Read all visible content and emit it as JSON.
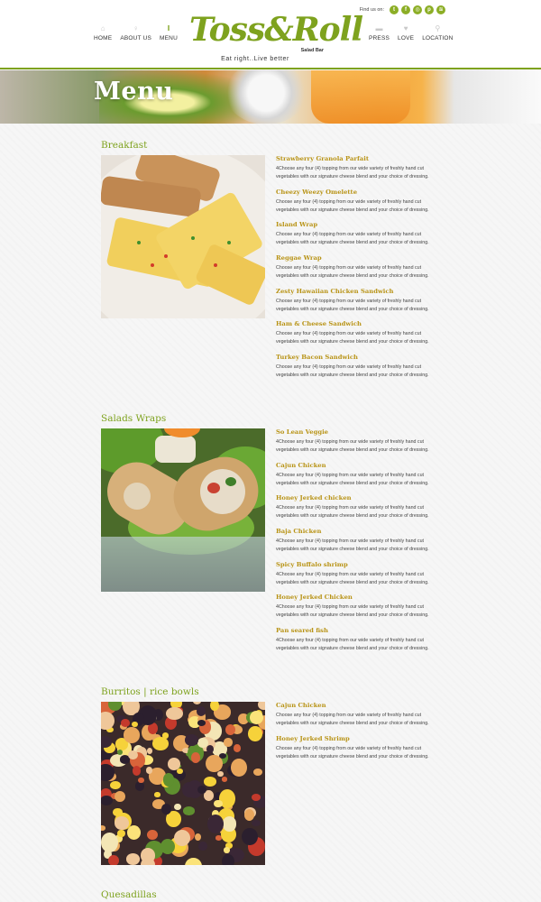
{
  "header": {
    "nav_left": [
      {
        "label": "HOME",
        "icon": "house-icon",
        "glyph": "⌂"
      },
      {
        "label": "ABOUT US",
        "icon": "person-icon",
        "glyph": "♀"
      },
      {
        "label": "MENU",
        "icon": "fork-knife-icon",
        "glyph": "ǁ"
      }
    ],
    "nav_right": [
      {
        "label": "PRESS",
        "icon": "chat-icon",
        "glyph": "▬"
      },
      {
        "label": "LOVE",
        "icon": "heart-icon",
        "glyph": "♥"
      },
      {
        "label": "LOCATION",
        "icon": "pin-icon",
        "glyph": "⚲"
      }
    ],
    "logo": {
      "script": "Toss&Roll",
      "sub": "Salad Bar",
      "tagline": "Eat right..Live better"
    },
    "find_us": {
      "label": "Find us on:",
      "icons": [
        {
          "name": "twitter-icon",
          "glyph": "t"
        },
        {
          "name": "facebook-icon",
          "glyph": "f"
        },
        {
          "name": "instagram-icon",
          "glyph": "◎"
        },
        {
          "name": "pinterest-icon",
          "glyph": "p"
        },
        {
          "name": "rss-icon",
          "glyph": "≋"
        }
      ]
    },
    "accent_color": "#7ea21e"
  },
  "banner": {
    "title": "Menu"
  },
  "sections": [
    {
      "title": "Breakfast",
      "items": [
        {
          "name": "Strawberry Granola Parfait",
          "desc": "4Choose any four (4) topping from our wide variety of freshly hand cut vegetables with our signature cheese blend and your choice of dressing."
        },
        {
          "name": "Cheezy Weezy Omelette",
          "desc": "Choose any four (4) topping from our wide variety of freshly hand cut vegetables with our signature cheese blend and your choice of dressing."
        },
        {
          "name": "Island Wrap",
          "desc": "Choose any four (4) topping from our wide variety of freshly hand cut vegetables with our signature cheese blend and your choice of dressing."
        },
        {
          "name": "Reggae Wrap",
          "desc": "Choose any four (4) topping from our wide variety of freshly hand cut vegetables with our signature cheese blend and your choice of dressing."
        },
        {
          "name": "Zesty Hawaiian Chicken Sandwich",
          "desc": "Choose any four (4) topping from our wide variety of freshly hand cut vegetables with our signature cheese blend and your choice of dressing."
        },
        {
          "name": "Ham & Cheese Sandwich",
          "desc": "Choose any four (4) topping from our wide variety of freshly hand cut vegetables with our signature cheese blend and your choice of dressing."
        },
        {
          "name": "Turkey Bacon Sandwich",
          "desc": "Choose any four (4) topping from our wide variety of freshly hand cut vegetables with our signature cheese blend and your choice of dressing."
        }
      ]
    },
    {
      "title": "Salads Wraps",
      "items": [
        {
          "name": "So Lean Veggie",
          "desc": "4Choose any four (4) topping from our wide variety of freshly hand cut vegetables with our signature cheese blend and your choice of dressing."
        },
        {
          "name": "Cajun Chicken",
          "desc": "4Choose any four (4) topping from our wide variety of freshly hand cut vegetables with our signature cheese blend and your choice of dressing."
        },
        {
          "name": "Honey Jerked chicken",
          "desc": "4Choose any four (4) topping from our wide variety of freshly hand cut vegetables with our signature cheese blend and your choice of dressing."
        },
        {
          "name": "Baja Chicken",
          "desc": "4Choose any four (4) topping from our wide variety of freshly hand cut vegetables with our signature cheese blend and your choice of dressing."
        },
        {
          "name": "Spicy Buffalo shrimp",
          "desc": "4Choose any four (4) topping from our wide variety of freshly hand cut vegetables with our signature cheese blend and your choice of dressing."
        },
        {
          "name": "Honey Jerked Chicken",
          "desc": "4Choose any four (4) topping from our wide variety of freshly hand cut vegetables with our signature cheese blend and your choice of dressing."
        },
        {
          "name": "Pan seared fish",
          "desc": "4Choose any four (4) topping from our wide variety of freshly hand cut vegetables with our signature cheese blend and your choice of dressing."
        }
      ]
    },
    {
      "title": "Burritos | rice bowls",
      "items": [
        {
          "name": "Cajun Chicken",
          "desc": "Choose any four (4) topping from our wide variety of freshly hand cut vegetables with our signature cheese blend and your choice of dressing."
        },
        {
          "name": "Honey Jerked Shrimp",
          "desc": "Choose any four (4) topping from our wide variety of freshly hand cut vegetables with our signature cheese blend and your choice of dressing."
        }
      ]
    }
  ],
  "next_section": {
    "title": "Quesadillas"
  }
}
